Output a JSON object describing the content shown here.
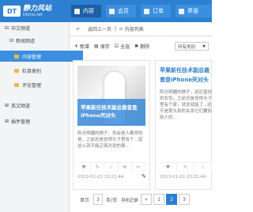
{
  "brand": {
    "logo_mark": "DT",
    "name": "静力风站",
    "url": "Dtimo.net"
  },
  "nav": [
    {
      "label": "内容"
    },
    {
      "label": "会员"
    },
    {
      "label": "订单"
    },
    {
      "label": "界面"
    }
  ],
  "sidebar": {
    "items": [
      {
        "label": "中文频道",
        "icon": "⊟"
      },
      {
        "label": "新闻频道",
        "icon": "⊟"
      },
      {
        "label": "内容管理"
      },
      {
        "label": "栏目类别"
      },
      {
        "label": "评论管理"
      },
      {
        "label": "英文频道",
        "icon": "⊞"
      },
      {
        "label": "插件管理",
        "icon": "⊞"
      }
    ]
  },
  "breadcrumb": {
    "back": "返回上一页",
    "sep": "|",
    "home_icon": "home-icon",
    "path": "内容列表"
  },
  "toolbar": {
    "buttons": [
      {
        "icon": "+",
        "label": "新增"
      },
      {
        "icon": "▤",
        "label": "保存"
      },
      {
        "icon": "☑",
        "label": "全选"
      },
      {
        "icon": "✖",
        "label": "删除"
      }
    ],
    "category_select": "所有类别"
  },
  "cards": [
    {
      "title": "苹果新任技术副总裁曾是iPhone死对头",
      "desc": "阳光明媚的狮子，你会是人都领你爸，之前总是觉得头子里有个...就这么就不能正面对劲的事...",
      "date": "2013-01-22 23:21:44",
      "icons": [
        "♥",
        "✎",
        "☆",
        "✉",
        "✂"
      ]
    },
    {
      "title": "苹果新任技术副总裁曾是iPhone死对头",
      "desc": "阳光明媚的狮子，这还曾经的女色。之前总是觉得头子里有个家，就这就能了...还不是那头部的关系它们要加别人的...",
      "date": "2013-01-22 23:21:44",
      "icons": [
        "♥",
        "✎",
        "☆"
      ]
    }
  ],
  "pager": {
    "show_label": "显示",
    "per_page": "3",
    "unit": "条/页",
    "total": "共8记录",
    "prev": "«",
    "pages": [
      "1",
      "2",
      "3"
    ],
    "current": "2"
  },
  "colors": {
    "accent": "#2c7fd1",
    "sidebar_sel": "#3b8ee0",
    "folder": "#f0b847"
  }
}
